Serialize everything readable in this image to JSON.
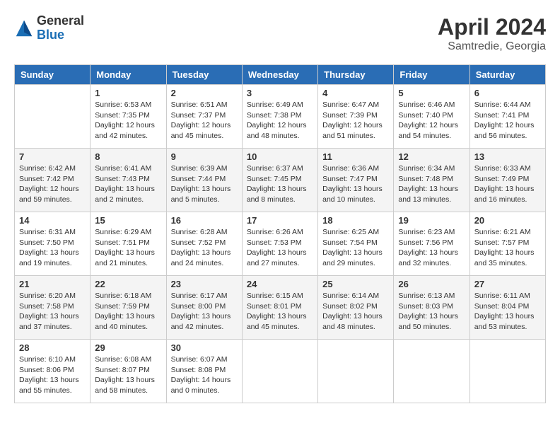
{
  "header": {
    "logo_general": "General",
    "logo_blue": "Blue",
    "month_title": "April 2024",
    "location": "Samtredie, Georgia"
  },
  "days_of_week": [
    "Sunday",
    "Monday",
    "Tuesday",
    "Wednesday",
    "Thursday",
    "Friday",
    "Saturday"
  ],
  "weeks": [
    [
      {
        "day": "",
        "info": ""
      },
      {
        "day": "1",
        "info": "Sunrise: 6:53 AM\nSunset: 7:35 PM\nDaylight: 12 hours\nand 42 minutes."
      },
      {
        "day": "2",
        "info": "Sunrise: 6:51 AM\nSunset: 7:37 PM\nDaylight: 12 hours\nand 45 minutes."
      },
      {
        "day": "3",
        "info": "Sunrise: 6:49 AM\nSunset: 7:38 PM\nDaylight: 12 hours\nand 48 minutes."
      },
      {
        "day": "4",
        "info": "Sunrise: 6:47 AM\nSunset: 7:39 PM\nDaylight: 12 hours\nand 51 minutes."
      },
      {
        "day": "5",
        "info": "Sunrise: 6:46 AM\nSunset: 7:40 PM\nDaylight: 12 hours\nand 54 minutes."
      },
      {
        "day": "6",
        "info": "Sunrise: 6:44 AM\nSunset: 7:41 PM\nDaylight: 12 hours\nand 56 minutes."
      }
    ],
    [
      {
        "day": "7",
        "info": "Sunrise: 6:42 AM\nSunset: 7:42 PM\nDaylight: 12 hours\nand 59 minutes."
      },
      {
        "day": "8",
        "info": "Sunrise: 6:41 AM\nSunset: 7:43 PM\nDaylight: 13 hours\nand 2 minutes."
      },
      {
        "day": "9",
        "info": "Sunrise: 6:39 AM\nSunset: 7:44 PM\nDaylight: 13 hours\nand 5 minutes."
      },
      {
        "day": "10",
        "info": "Sunrise: 6:37 AM\nSunset: 7:45 PM\nDaylight: 13 hours\nand 8 minutes."
      },
      {
        "day": "11",
        "info": "Sunrise: 6:36 AM\nSunset: 7:47 PM\nDaylight: 13 hours\nand 10 minutes."
      },
      {
        "day": "12",
        "info": "Sunrise: 6:34 AM\nSunset: 7:48 PM\nDaylight: 13 hours\nand 13 minutes."
      },
      {
        "day": "13",
        "info": "Sunrise: 6:33 AM\nSunset: 7:49 PM\nDaylight: 13 hours\nand 16 minutes."
      }
    ],
    [
      {
        "day": "14",
        "info": "Sunrise: 6:31 AM\nSunset: 7:50 PM\nDaylight: 13 hours\nand 19 minutes."
      },
      {
        "day": "15",
        "info": "Sunrise: 6:29 AM\nSunset: 7:51 PM\nDaylight: 13 hours\nand 21 minutes."
      },
      {
        "day": "16",
        "info": "Sunrise: 6:28 AM\nSunset: 7:52 PM\nDaylight: 13 hours\nand 24 minutes."
      },
      {
        "day": "17",
        "info": "Sunrise: 6:26 AM\nSunset: 7:53 PM\nDaylight: 13 hours\nand 27 minutes."
      },
      {
        "day": "18",
        "info": "Sunrise: 6:25 AM\nSunset: 7:54 PM\nDaylight: 13 hours\nand 29 minutes."
      },
      {
        "day": "19",
        "info": "Sunrise: 6:23 AM\nSunset: 7:56 PM\nDaylight: 13 hours\nand 32 minutes."
      },
      {
        "day": "20",
        "info": "Sunrise: 6:21 AM\nSunset: 7:57 PM\nDaylight: 13 hours\nand 35 minutes."
      }
    ],
    [
      {
        "day": "21",
        "info": "Sunrise: 6:20 AM\nSunset: 7:58 PM\nDaylight: 13 hours\nand 37 minutes."
      },
      {
        "day": "22",
        "info": "Sunrise: 6:18 AM\nSunset: 7:59 PM\nDaylight: 13 hours\nand 40 minutes."
      },
      {
        "day": "23",
        "info": "Sunrise: 6:17 AM\nSunset: 8:00 PM\nDaylight: 13 hours\nand 42 minutes."
      },
      {
        "day": "24",
        "info": "Sunrise: 6:15 AM\nSunset: 8:01 PM\nDaylight: 13 hours\nand 45 minutes."
      },
      {
        "day": "25",
        "info": "Sunrise: 6:14 AM\nSunset: 8:02 PM\nDaylight: 13 hours\nand 48 minutes."
      },
      {
        "day": "26",
        "info": "Sunrise: 6:13 AM\nSunset: 8:03 PM\nDaylight: 13 hours\nand 50 minutes."
      },
      {
        "day": "27",
        "info": "Sunrise: 6:11 AM\nSunset: 8:04 PM\nDaylight: 13 hours\nand 53 minutes."
      }
    ],
    [
      {
        "day": "28",
        "info": "Sunrise: 6:10 AM\nSunset: 8:06 PM\nDaylight: 13 hours\nand 55 minutes."
      },
      {
        "day": "29",
        "info": "Sunrise: 6:08 AM\nSunset: 8:07 PM\nDaylight: 13 hours\nand 58 minutes."
      },
      {
        "day": "30",
        "info": "Sunrise: 6:07 AM\nSunset: 8:08 PM\nDaylight: 14 hours\nand 0 minutes."
      },
      {
        "day": "",
        "info": ""
      },
      {
        "day": "",
        "info": ""
      },
      {
        "day": "",
        "info": ""
      },
      {
        "day": "",
        "info": ""
      }
    ]
  ]
}
